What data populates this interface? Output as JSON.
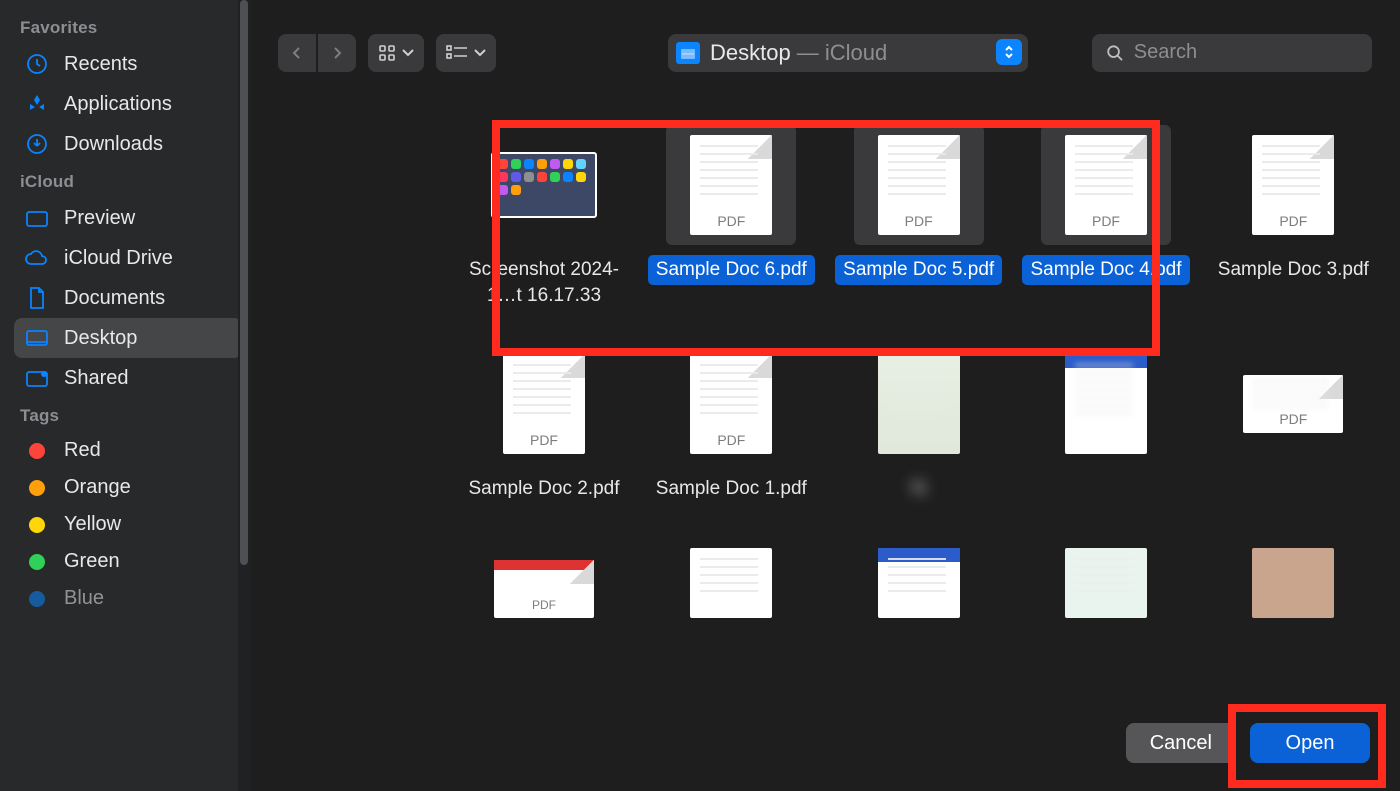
{
  "sidebar": {
    "sections": {
      "favorites": {
        "label": "Favorites",
        "items": [
          {
            "name": "recents",
            "label": "Recents"
          },
          {
            "name": "applications",
            "label": "Applications"
          },
          {
            "name": "downloads",
            "label": "Downloads"
          }
        ]
      },
      "icloud": {
        "label": "iCloud",
        "items": [
          {
            "name": "preview",
            "label": "Preview"
          },
          {
            "name": "icloud-drive",
            "label": "iCloud Drive"
          },
          {
            "name": "documents",
            "label": "Documents"
          },
          {
            "name": "desktop",
            "label": "Desktop",
            "active": true
          },
          {
            "name": "shared",
            "label": "Shared"
          }
        ]
      },
      "tags": {
        "label": "Tags",
        "items": [
          {
            "name": "red",
            "label": "Red",
            "color": "#ff453a"
          },
          {
            "name": "orange",
            "label": "Orange",
            "color": "#ff9f0a"
          },
          {
            "name": "yellow",
            "label": "Yellow",
            "color": "#ffd60a"
          },
          {
            "name": "green",
            "label": "Green",
            "color": "#30d158"
          },
          {
            "name": "blue",
            "label": "Blue",
            "color": "#0a84ff"
          }
        ]
      }
    }
  },
  "toolbar": {
    "path": {
      "label": "Desktop",
      "suffix": " — iCloud"
    },
    "search": {
      "placeholder": "Search"
    }
  },
  "files": {
    "row1": [
      {
        "name": "Screenshot 2024-1…t 16.17.33",
        "kind": "image"
      },
      {
        "name": "Sample Doc 6.pdf",
        "kind": "pdf",
        "selected": true
      },
      {
        "name": "Sample Doc 5.pdf",
        "kind": "pdf",
        "selected": true
      },
      {
        "name": "Sample Doc 4.pdf",
        "kind": "pdf",
        "selected": true
      },
      {
        "name": "Sample Doc 3.pdf",
        "kind": "pdf"
      }
    ],
    "row2": [
      {
        "name": "Sample Doc 2.pdf",
        "kind": "pdf"
      },
      {
        "name": "Sample Doc 1.pdf",
        "kind": "pdf"
      },
      {
        "name": "N",
        "kind": "card",
        "blur": true
      },
      {
        "name": " ",
        "kind": "banner",
        "blur": true
      },
      {
        "name": " ",
        "kind": "smallwide",
        "blur": true
      }
    ],
    "row3": [
      {
        "name": "",
        "kind": "redtop"
      },
      {
        "name": "",
        "kind": "pdf"
      },
      {
        "name": "",
        "kind": "banner"
      },
      {
        "name": "",
        "kind": "cert"
      },
      {
        "name": "",
        "kind": "photo",
        "blur": true
      }
    ],
    "pdf_badge": "PDF"
  },
  "footer": {
    "cancel_label": "Cancel",
    "open_label": "Open"
  }
}
